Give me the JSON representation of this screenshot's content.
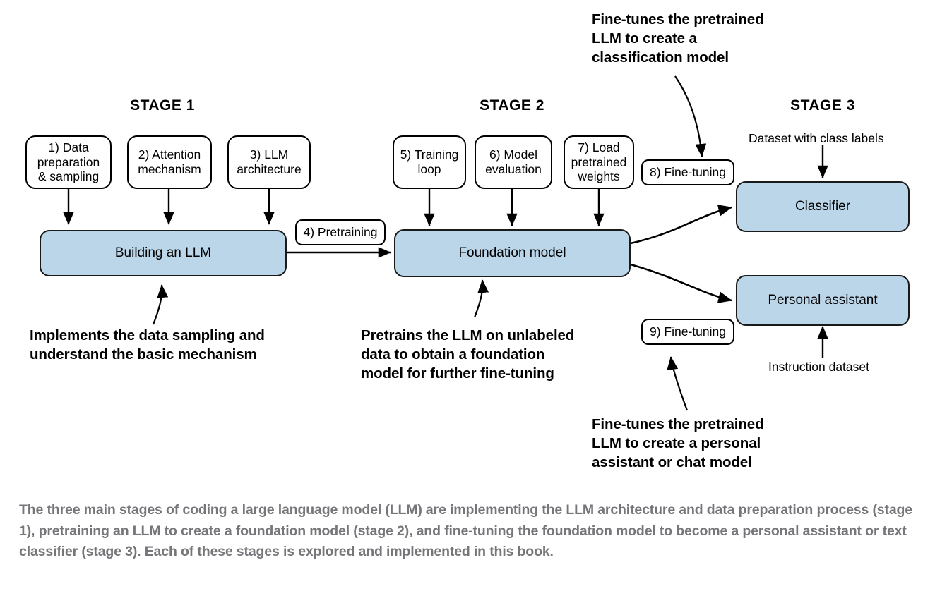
{
  "figure": {
    "title_stage1": "STAGE 1",
    "title_stage2": "STAGE 2",
    "title_stage3": "STAGE 3"
  },
  "stage1": {
    "steps": [
      {
        "id": "step-1",
        "label": "1) Data\npreparation\n& sampling"
      },
      {
        "id": "step-2",
        "label": "2) Attention\nmechanism"
      },
      {
        "id": "step-3",
        "label": "3) LLM\narchitecture"
      }
    ],
    "main_box": "Building an LLM",
    "annotation": "Implements the data sampling and\nunderstand the basic mechanism"
  },
  "stage2": {
    "transition_pill": "4) Pretraining",
    "steps": [
      {
        "id": "step-5",
        "label": "5) Training\nloop"
      },
      {
        "id": "step-6",
        "label": "6) Model\nevaluation"
      },
      {
        "id": "step-7",
        "label": "7) Load\npretrained\nweights"
      }
    ],
    "main_box": "Foundation model",
    "annotation": "Pretrains the LLM on unlabeled\ndata to obtain a foundation\nmodel for further fine-tuning"
  },
  "stage3": {
    "finetune_pill_classifier": "8) Fine-tuning",
    "finetune_pill_assistant": "9) Fine-tuning",
    "dataset_label_classifier": "Dataset with class labels",
    "dataset_label_assistant": "Instruction dataset",
    "output_classifier": "Classifier",
    "output_assistant": "Personal assistant",
    "annotation_classifier": "Fine-tunes the pretrained\nLLM to create a\nclassification model",
    "annotation_assistant": "Fine-tunes the pretrained\nLLM to create a personal\nassistant or chat model"
  },
  "caption": {
    "text": "The three main stages of coding a large language model (LLM) are implementing the LLM architecture and data preparation process (stage 1), pretraining an LLM to create a foundation model (stage 2), and fine-tuning the foundation model to become a personal assistant or text classifier (stage 3). Each of these stages is explored and implemented in this book."
  },
  "colors": {
    "blue_fill": "#bbd5e9",
    "stroke": "#000000",
    "caption_grey": "#76767a"
  }
}
